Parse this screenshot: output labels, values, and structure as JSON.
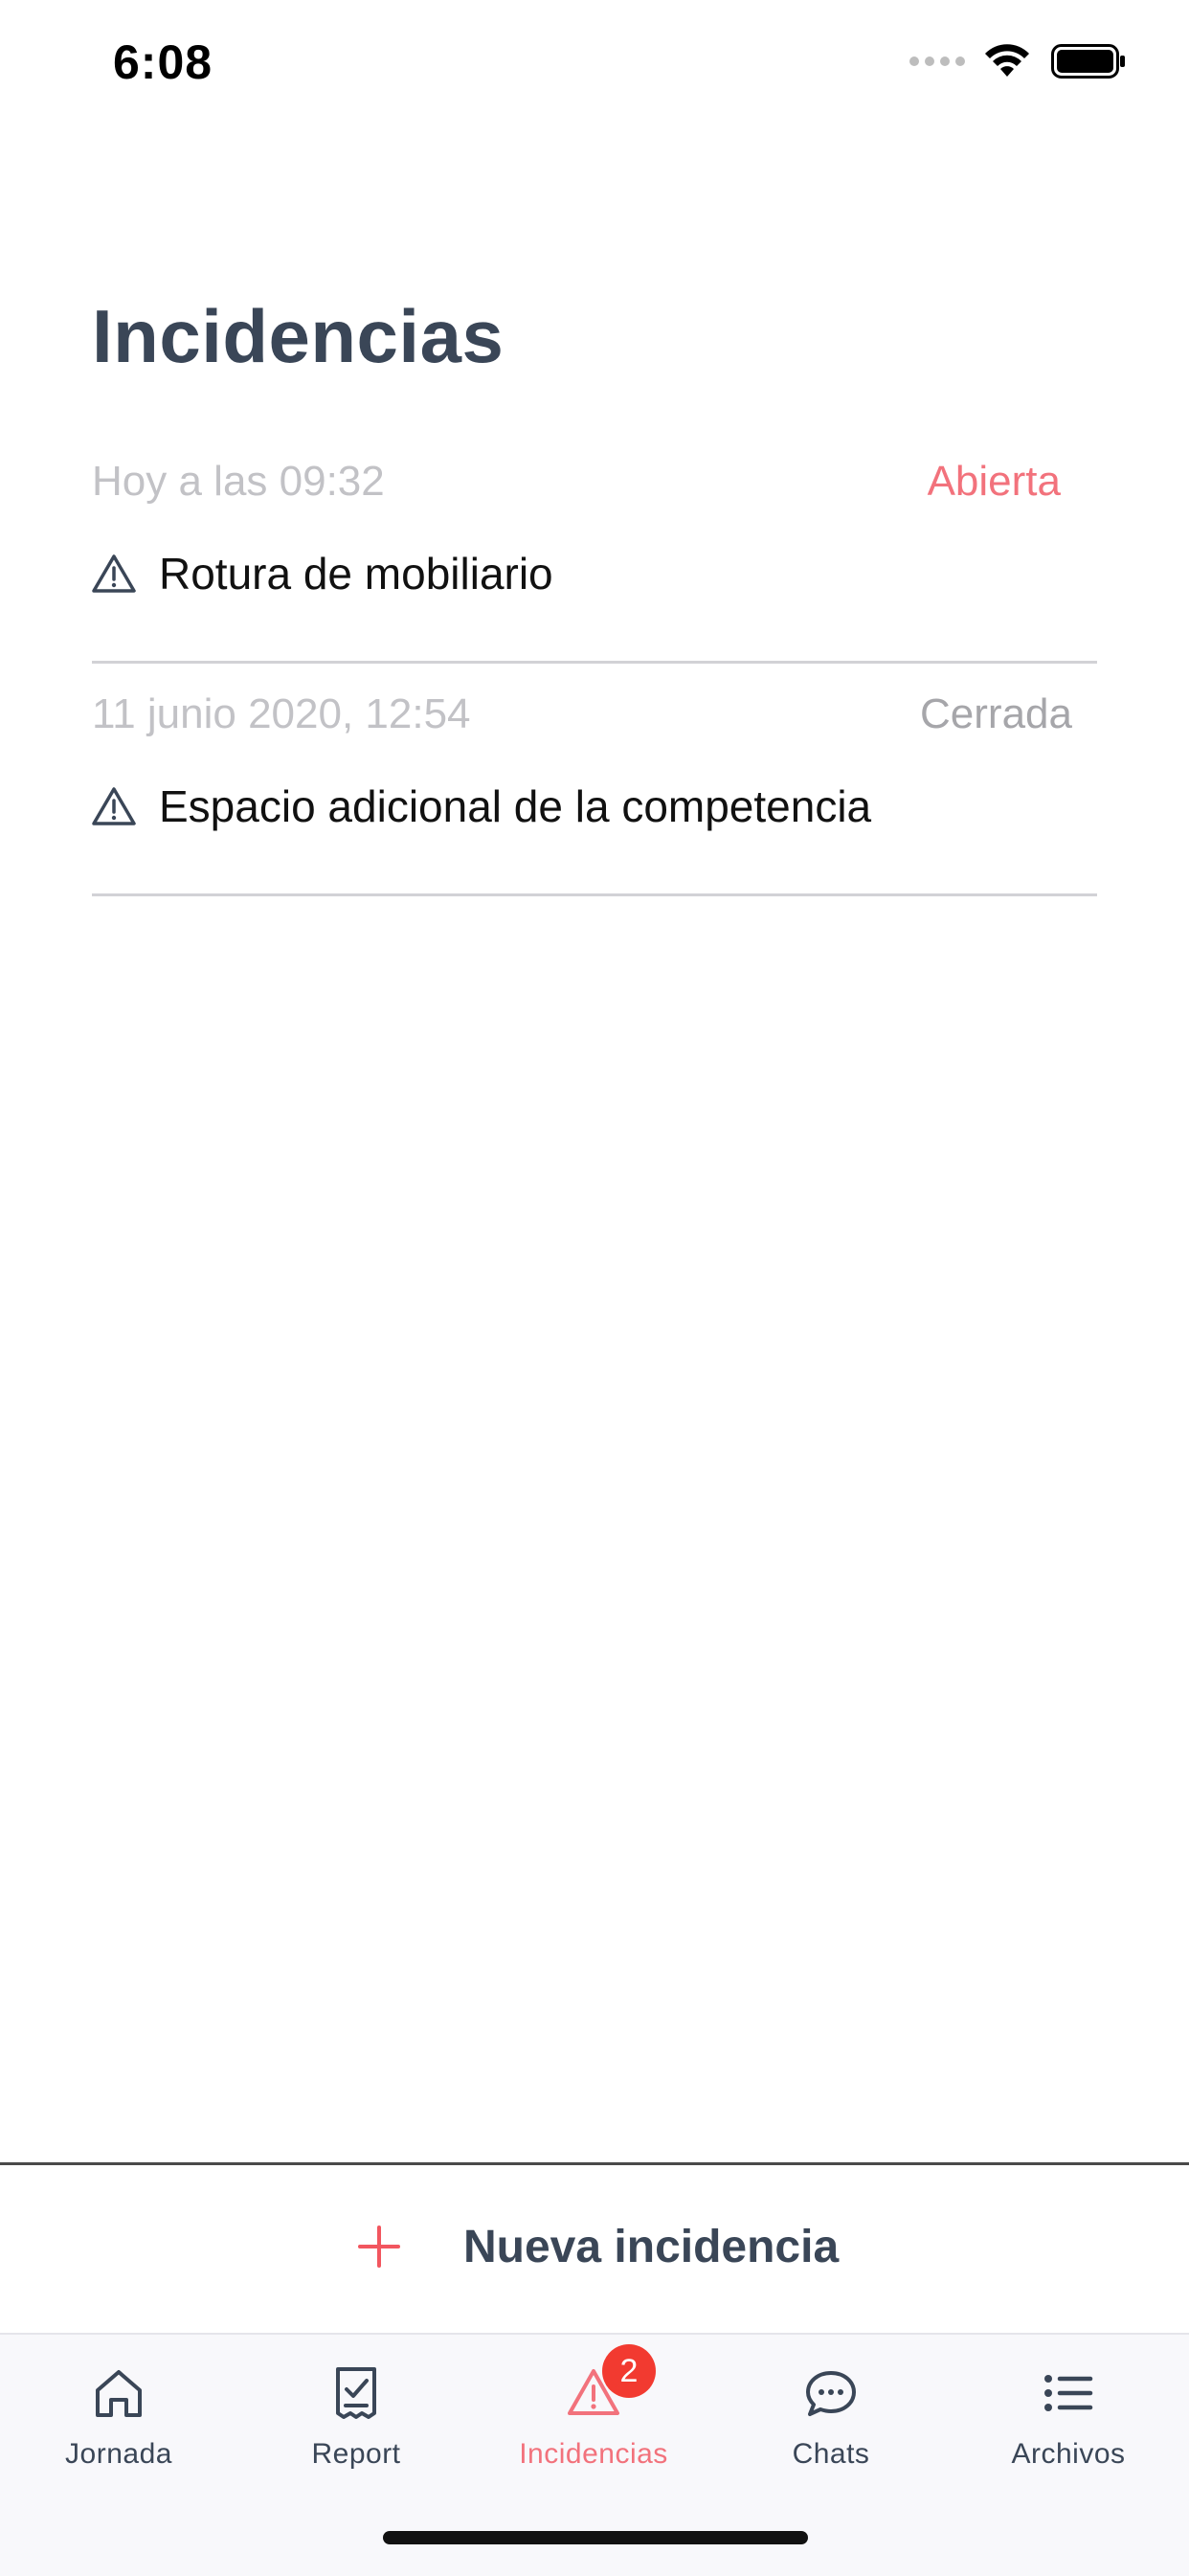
{
  "status_bar": {
    "time": "6:08"
  },
  "page": {
    "title": "Incidencias"
  },
  "incidents": [
    {
      "date": "Hoy a las 09:32",
      "status": "Abierta",
      "title": "Rotura de mobiliario"
    },
    {
      "date": "11 junio 2020, 12:54",
      "status": "Cerrada",
      "title": "Espacio adicional de la competencia"
    }
  ],
  "new_incident": {
    "label": "Nueva incidencia",
    "icon": "plus-icon"
  },
  "tabs": [
    {
      "label": "Jornada",
      "icon": "home-icon"
    },
    {
      "label": "Report",
      "icon": "report-icon"
    },
    {
      "label": "Incidencias",
      "icon": "warning-icon",
      "badge": "2",
      "active": true
    },
    {
      "label": "Chats",
      "icon": "chat-icon"
    },
    {
      "label": "Archivos",
      "icon": "list-icon"
    }
  ],
  "colors": {
    "accent": "#f2727c",
    "title": "#3a4657",
    "badge": "#f23a30",
    "muted": "#c2c2c6"
  }
}
